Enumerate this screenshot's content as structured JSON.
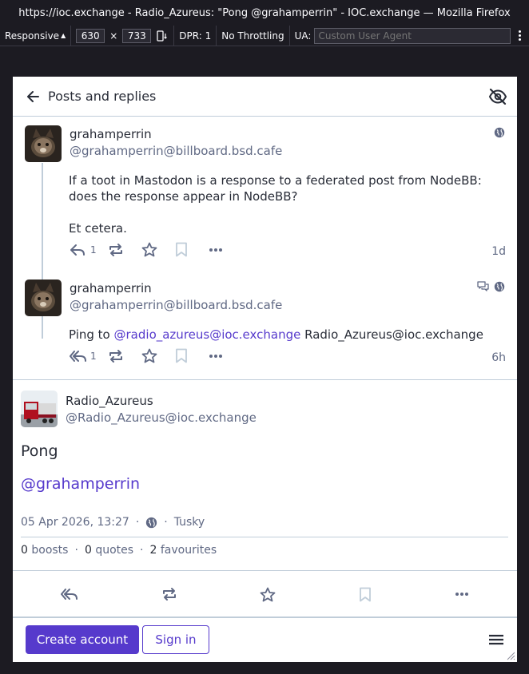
{
  "browser": {
    "window_title": "https://ioc.exchange - Radio_Azureus: \"Pong @grahamperrin\" - IOC.exchange — Mozilla Firefox",
    "responsive_label": "Responsive",
    "width": "630",
    "times": "×",
    "height": "733",
    "dpr_label": "DPR: 1",
    "throttling_label": "No Throttling",
    "ua_label": "UA:",
    "ua_placeholder": "Custom User Agent"
  },
  "header": {
    "title": "Posts and replies"
  },
  "statuses": [
    {
      "display_name": "grahamperrin",
      "acct": "@grahamperrin@billboard.bsd.cafe",
      "paragraphs": [
        "If a toot in Mastodon is a response to a federated post from NodeBB: does the response appear in NodeBB?",
        "Et cetera."
      ],
      "reply_count": "1",
      "time": "1d"
    },
    {
      "display_name": "grahamperrin",
      "acct": "@grahamperrin@billboard.bsd.cafe",
      "content_prefix": "Ping to ",
      "content_mention": "@radio_azureus@ioc.exchange",
      "content_suffix": " Radio_Azureus@ioc.exchange",
      "reply_count": "1",
      "time": "6h"
    }
  ],
  "focal": {
    "display_name": "Radio_Azureus",
    "acct": "@Radio_Azureus@ioc.exchange",
    "text": "Pong",
    "mention": "@grahamperrin",
    "date": "05 Apr 2026, 13:27",
    "sep1": "·",
    "sep2": "·",
    "app": "Tusky",
    "boosts_count": "0",
    "boosts_label": "boosts",
    "quotes_count": "0",
    "quotes_label": "quotes",
    "favourites_count": "2",
    "favourites_label": "favourites",
    "dot": "·"
  },
  "bottom": {
    "create_account": "Create account",
    "sign_in": "Sign in"
  },
  "icons": [
    "arrow-left-icon",
    "visibility-off-icon",
    "globe-icon",
    "reply-icon",
    "reply-all-icon",
    "boost-icon",
    "star-icon",
    "bookmark-icon",
    "more-icon",
    "quote-icon",
    "menu-icon"
  ]
}
